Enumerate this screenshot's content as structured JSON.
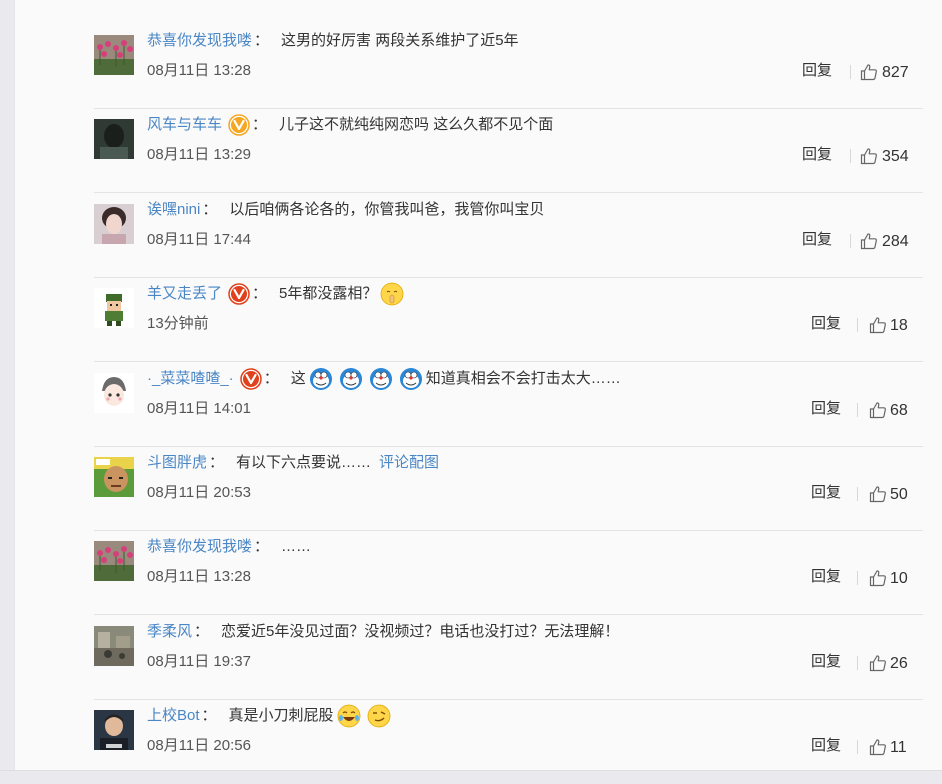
{
  "comments": [
    {
      "user": "恭喜你发现我喽",
      "verified": false,
      "colon": "：",
      "text": "这男的好厉害 两段关系维护了近5年",
      "link": "",
      "emojis": [],
      "time": "08月11日 13:28",
      "reply": "回复",
      "likes": "827",
      "avatar": "tulips"
    },
    {
      "user": "风车与车车",
      "verified": "gold",
      "colon": "：",
      "text": "儿子这不就纯纯网恋吗 这么久都不见个面",
      "link": "",
      "emojis": [],
      "time": "08月11日 13:29",
      "reply": "回复",
      "likes": "354",
      "avatar": "person-back"
    },
    {
      "user": "诶嘿nini",
      "verified": false,
      "colon": "：",
      "text": "以后咱俩各论各的，你管我叫爸，我管你叫宝贝",
      "link": "",
      "emojis": [],
      "time": "08月11日 17:44",
      "reply": "回复",
      "likes": "284",
      "avatar": "girl"
    },
    {
      "user": "羊又走丢了",
      "verified": "red",
      "colon": "：",
      "text": "5年都没露相？",
      "link": "",
      "emojis": [
        "shush-emoji"
      ],
      "time": "13分钟前",
      "reply": "回复",
      "likes": "18",
      "avatar": "soldier"
    },
    {
      "user": "·_菜菜喳喳_·",
      "verified": "red",
      "colon": "：",
      "text_before": "这",
      "text": "知道真相会不会打击太大……",
      "link": "",
      "emojis": [
        "doraemon-emoji",
        "doraemon-emoji",
        "doraemon-emoji",
        "doraemon-emoji"
      ],
      "time": "08月11日 14:01",
      "reply": "回复",
      "likes": "68",
      "avatar": "anime-boy"
    },
    {
      "user": "斗图胖虎",
      "verified": false,
      "colon": "：",
      "text": "有以下六点要说……",
      "link": "评论配图",
      "emojis": [],
      "time": "08月11日 20:53",
      "reply": "回复",
      "likes": "50",
      "avatar": "meme-face"
    },
    {
      "user": "恭喜你发现我喽",
      "verified": false,
      "colon": "：",
      "text": "……",
      "link": "",
      "emojis": [],
      "time": "08月11日 13:28",
      "reply": "回复",
      "likes": "10",
      "avatar": "tulips"
    },
    {
      "user": "季柔风",
      "verified": false,
      "colon": "：",
      "text": "恋爱近5年没见过面？没视频过？电话也没打过？无法理解！",
      "link": "",
      "emojis": [],
      "time": "08月11日 19:37",
      "reply": "回复",
      "likes": "26",
      "avatar": "street"
    },
    {
      "user": "上校Bot",
      "verified": false,
      "colon": "：",
      "text": "真是小刀刺屁股",
      "link": "",
      "emojis": [
        "laugh-cry-emoji",
        "smirk-emoji"
      ],
      "time": "08月11日 20:56",
      "reply": "回复",
      "likes": "11",
      "avatar": "man-portrait"
    }
  ],
  "colors": {
    "username": "#4a86c5",
    "text": "#333333",
    "divider": "#e3e3e3",
    "gold_badge": "#f5a623",
    "red_badge": "#e0401b"
  }
}
